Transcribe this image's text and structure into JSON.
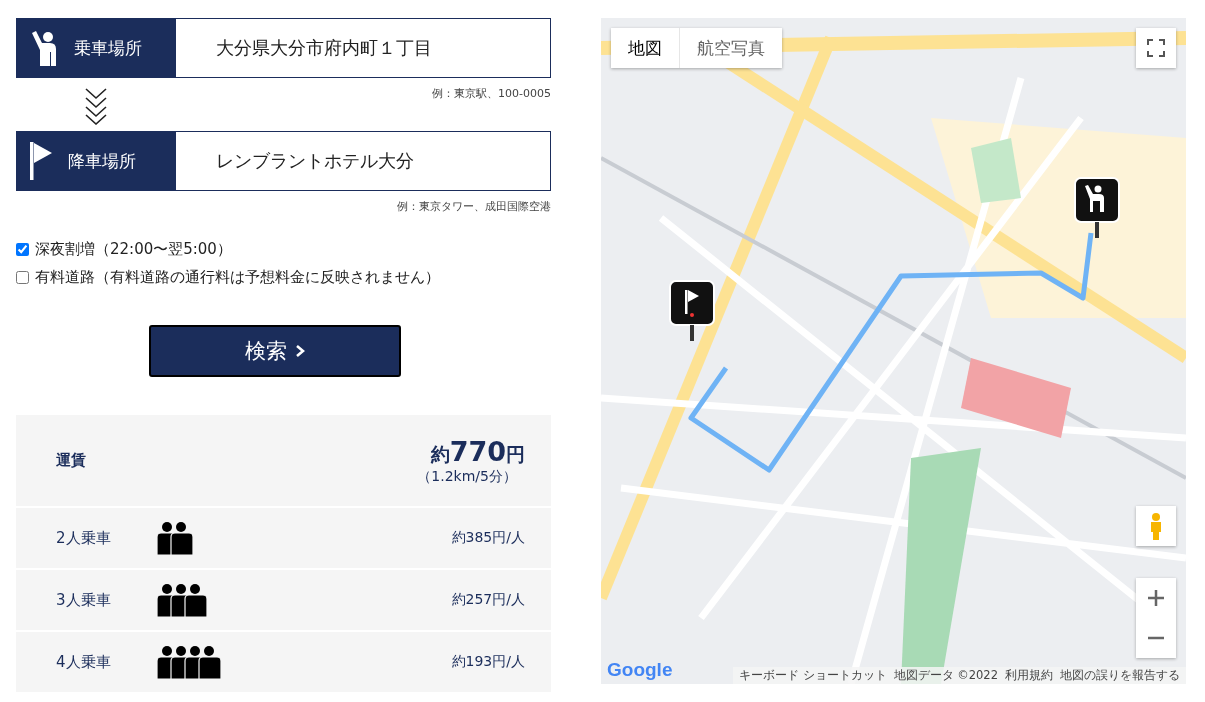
{
  "pickup": {
    "label": "乗車場所",
    "value": "大分県大分市府内町１丁目",
    "example": "例：東京駅、100-0005"
  },
  "dropoff": {
    "label": "降車場所",
    "value": "レンブラントホテル大分",
    "example": "例：東京タワー、成田国際空港"
  },
  "options": [
    {
      "label": "深夜割増（22:00〜翌5:00）",
      "checked": true
    },
    {
      "label": "有料道路（有料道路の通行料は予想料金に反映されません）",
      "checked": false
    }
  ],
  "search_button": "検索",
  "fare": {
    "label": "運賃",
    "prefix": "約",
    "amount": "770",
    "unit": "円",
    "detail": "（1.2km/5分）"
  },
  "shares": [
    {
      "label": "2人乗車",
      "price": "約385円/人"
    },
    {
      "label": "3人乗車",
      "price": "約257円/人"
    },
    {
      "label": "4人乗車",
      "price": "約193円/人"
    }
  ],
  "map": {
    "tabs": [
      {
        "label": "地図",
        "selected": true
      },
      {
        "label": "航空写真",
        "selected": false
      }
    ],
    "logo": "Google",
    "footer": [
      "キーボード ショートカット",
      "地図データ ©2022",
      "利用規約",
      "地図の誤りを報告する"
    ]
  }
}
